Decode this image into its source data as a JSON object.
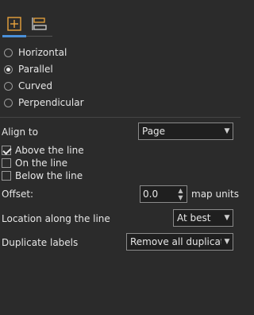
{
  "tabs": [
    {
      "icon": "label-position-icon",
      "active": true
    },
    {
      "icon": "label-layout-icon",
      "active": false
    }
  ],
  "orientation": {
    "options": [
      "Horizontal",
      "Parallel",
      "Curved",
      "Perpendicular"
    ],
    "selected": "Parallel"
  },
  "align_to": {
    "label": "Align to",
    "value": "Page"
  },
  "line_position": {
    "above": {
      "label": "Above the line",
      "checked": true
    },
    "on": {
      "label": "On the line",
      "checked": false
    },
    "below": {
      "label": "Below the line",
      "checked": false
    }
  },
  "offset": {
    "label": "Offset:",
    "value": "0.0",
    "unit": "map units"
  },
  "location": {
    "label": "Location along the line",
    "value": "At best"
  },
  "duplicates": {
    "label": "Duplicate labels",
    "value": "Remove all duplicates"
  },
  "colors": {
    "background": "#2b2b2b",
    "accent": "#4a90d9",
    "icon_orange": "#e8a33d"
  }
}
